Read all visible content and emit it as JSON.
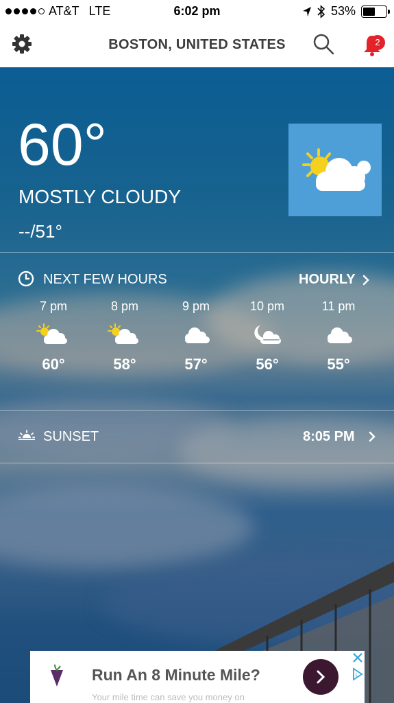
{
  "status_bar": {
    "carrier": "AT&T",
    "network": "LTE",
    "time": "6:02 pm",
    "battery": "53%",
    "battery_level": 0.53,
    "signal_bars": 4
  },
  "header": {
    "title": "BOSTON, UNITED STATES",
    "notification_count": "2"
  },
  "current": {
    "temperature": "60°",
    "condition": "MOSTLY CLOUDY",
    "hi_lo": "--/51°",
    "icon": "partly-cloudy-icon"
  },
  "next_hours": {
    "label": "NEXT FEW HOURS",
    "link": "HOURLY",
    "items": [
      {
        "time": "7 pm",
        "temp": "60°",
        "icon": "partly-cloudy-icon"
      },
      {
        "time": "8 pm",
        "temp": "58°",
        "icon": "partly-cloudy-icon"
      },
      {
        "time": "9 pm",
        "temp": "57°",
        "icon": "cloud-icon"
      },
      {
        "time": "10 pm",
        "temp": "56°",
        "icon": "moon-cloud-icon"
      },
      {
        "time": "11 pm",
        "temp": "55°",
        "icon": "cloud-icon"
      }
    ]
  },
  "sunset": {
    "label": "SUNSET",
    "time": "8:05 PM"
  },
  "ad": {
    "headline": "Run An 8 Minute Mile?",
    "subtext": "Your mile time can save you money on"
  },
  "colors": {
    "accent_sky": "#1a5f90",
    "badge": "#e4222a",
    "tile": "#4e9fd8",
    "ad_button": "#3b1830"
  }
}
